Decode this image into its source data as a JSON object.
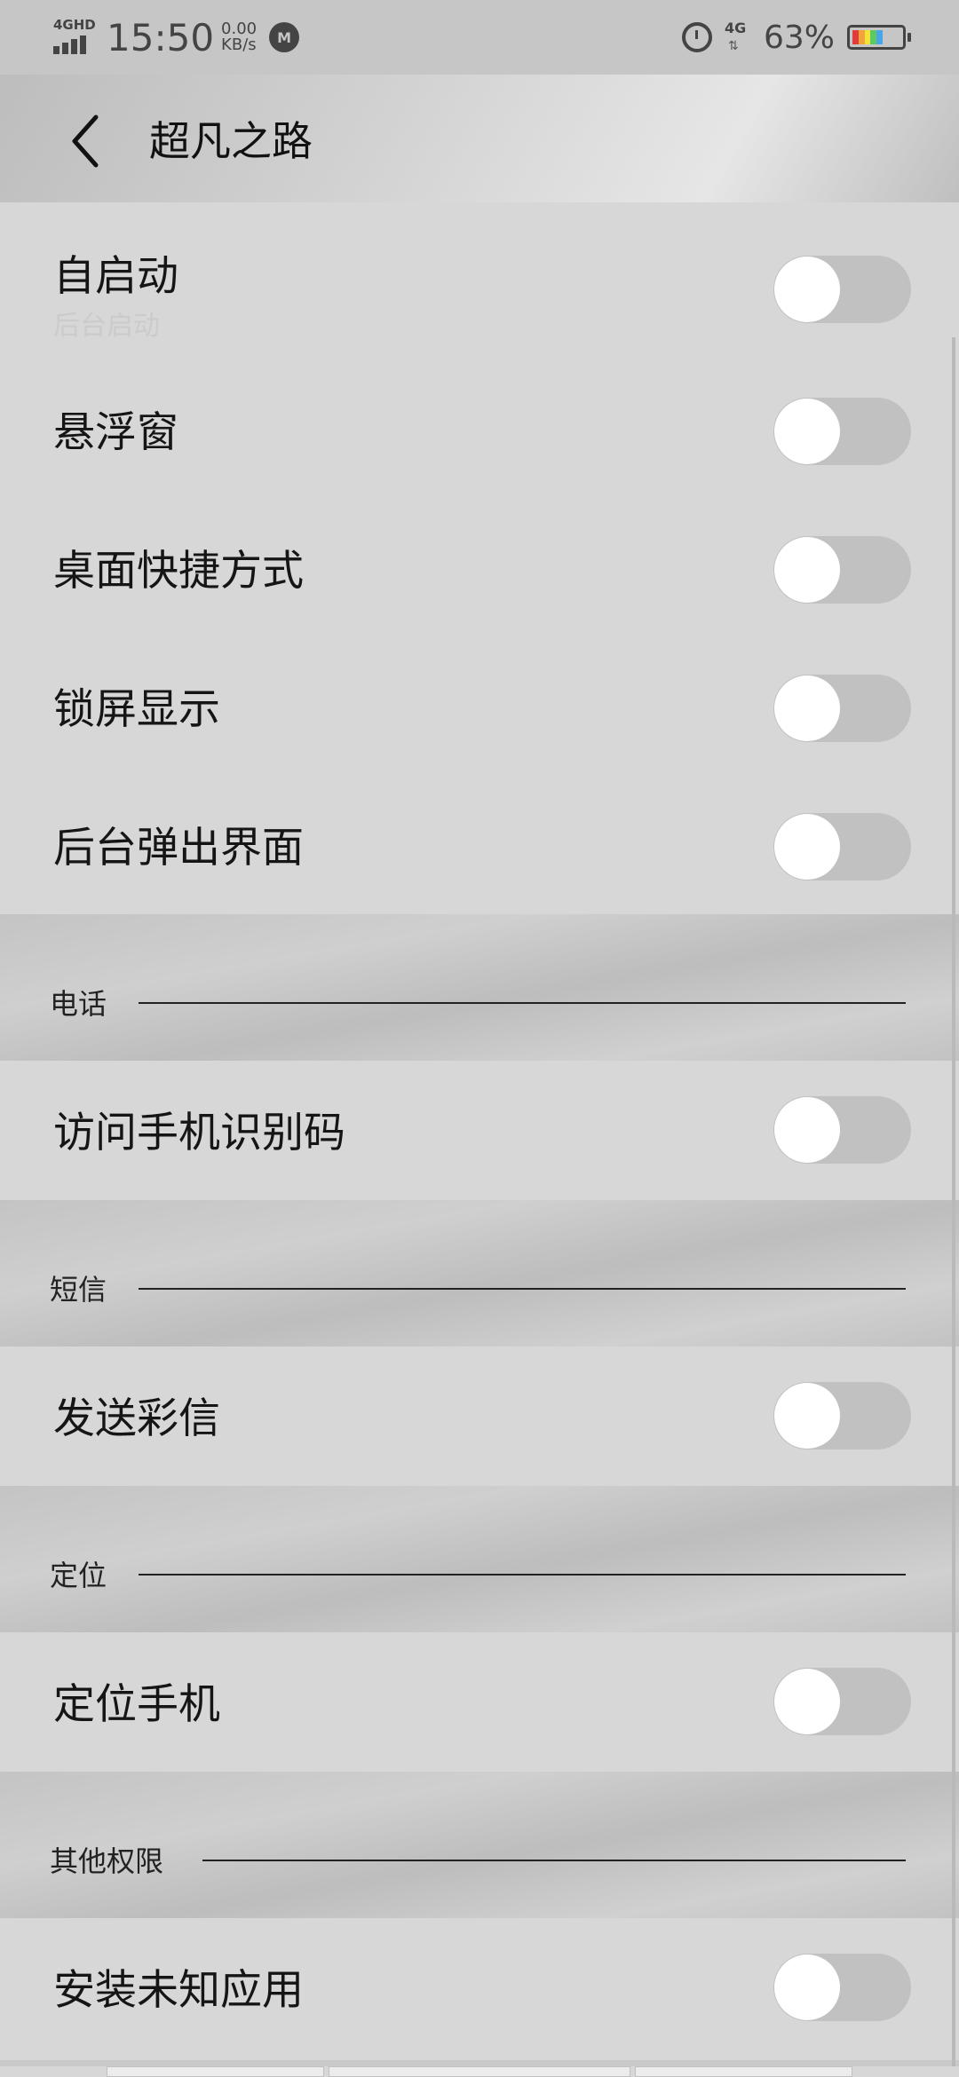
{
  "status_bar": {
    "network_type": "4GHD",
    "time": "15:50",
    "speed_value": "0.00",
    "speed_unit": "KB/s",
    "mi_icon": "mi-icon",
    "alarm_icon": "alarm-icon",
    "signal_4g": "4G",
    "battery_percent": "63%",
    "battery_colors": [
      "#e23b3b",
      "#f2a33a",
      "#f3e23a",
      "#5ec95e",
      "#4aa5e8"
    ],
    "battery_level": 0.63
  },
  "header": {
    "back_icon": "chevron-left-icon",
    "title": "超凡之路"
  },
  "rows": [
    {
      "label": "自启动",
      "sublabel": "后台启动",
      "enabled": false
    },
    {
      "label": "悬浮窗",
      "enabled": false
    },
    {
      "label": "桌面快捷方式",
      "enabled": false
    },
    {
      "label": "锁屏显示",
      "enabled": false
    },
    {
      "label": "后台弹出界面",
      "enabled": false
    }
  ],
  "sections": [
    {
      "title": "电话",
      "rows": [
        {
          "label": "访问手机识别码",
          "enabled": false
        }
      ]
    },
    {
      "title": "短信",
      "rows": [
        {
          "label": "发送彩信",
          "enabled": false
        }
      ]
    },
    {
      "title": "定位",
      "rows": [
        {
          "label": "定位手机",
          "enabled": false
        }
      ]
    },
    {
      "title": "其他权限",
      "rows": [
        {
          "label": "安装未知应用",
          "enabled": false
        }
      ]
    }
  ],
  "colors": {
    "row_bg": "#d7d7d7",
    "toggle_track_off": "#c1c1c1",
    "toggle_knob": "#ffffff",
    "text": "#151515"
  }
}
